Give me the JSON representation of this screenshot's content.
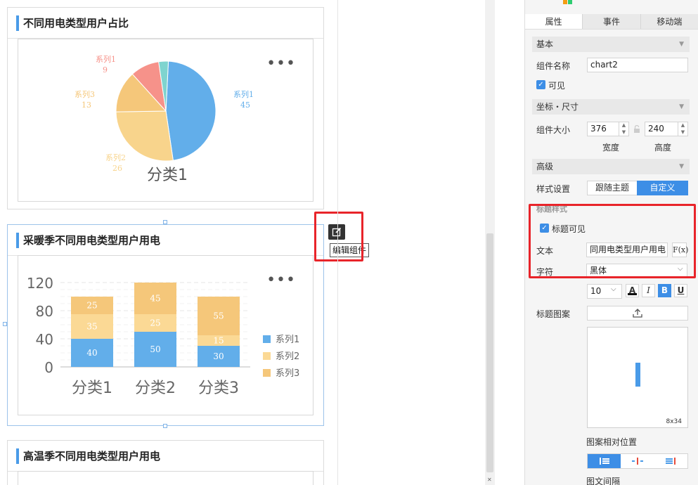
{
  "canvas": {
    "widget1": {
      "title": "不同用电类型用户占比",
      "more_label": "•••",
      "pie": {
        "category": "分类1",
        "slices": [
          {
            "name": "系列1",
            "value": 45,
            "color": "#62aeea"
          },
          {
            "name": "系列2",
            "value": 26,
            "color": "#f8d48c"
          },
          {
            "name": "系列3",
            "value": 13,
            "color": "#f5c77a"
          },
          {
            "name": "系列1",
            "value": 9,
            "color": "#f6928a"
          }
        ]
      }
    },
    "widget2": {
      "title": "采暖季不同用电类型用户用电",
      "more_label": "•••",
      "chart_data": {
        "type": "bar",
        "stacked": true,
        "categories": [
          "分类1",
          "分类2",
          "分类3"
        ],
        "series": [
          {
            "name": "系列1",
            "values": [
              40,
              50,
              30
            ],
            "color": "#62aeea"
          },
          {
            "name": "系列2",
            "values": [
              35,
              25,
              15
            ],
            "color": "#fbd995"
          },
          {
            "name": "系列3",
            "values": [
              25,
              45,
              55
            ],
            "color": "#f5c77a"
          }
        ],
        "y_ticks": [
          "0",
          "40",
          "80",
          "120"
        ],
        "ylim": [
          0,
          120
        ],
        "legend_position": "right"
      }
    },
    "widget3": {
      "title": "高温季不同用电类型用户用电"
    },
    "edit_tooltip": "编辑组件"
  },
  "panel": {
    "tabs": [
      {
        "label": "属性",
        "active": true
      },
      {
        "label": "事件",
        "active": false
      },
      {
        "label": "移动端",
        "active": false
      }
    ],
    "basic": {
      "header": "基本",
      "name_label": "组件名称",
      "name_value": "chart2",
      "visible_label": "可见"
    },
    "position": {
      "header": "坐标・尺寸",
      "size_label": "组件大小",
      "width_value": "376",
      "height_value": "240",
      "width_label": "宽度",
      "height_label": "高度"
    },
    "advanced": {
      "header": "高级",
      "style_label": "样式设置",
      "style_options": [
        "跟随主题",
        "自定义"
      ],
      "style_selected": "自定义"
    },
    "title_style": {
      "header": "标题样式",
      "title_visible_label": "标题可见",
      "text_label": "文本",
      "text_value": "同用电类型用户用电",
      "fx_label": "F(x)",
      "font_label": "字符",
      "font_value": "黑体",
      "font_size": "10",
      "bold_label": "B",
      "italic_label": "I",
      "underline_label": "U",
      "color_label": "A",
      "pattern_label": "标题图案",
      "preview_size": "8x34",
      "relative_position_label": "图案相对位置",
      "spacing_label": "图文间隔"
    }
  }
}
